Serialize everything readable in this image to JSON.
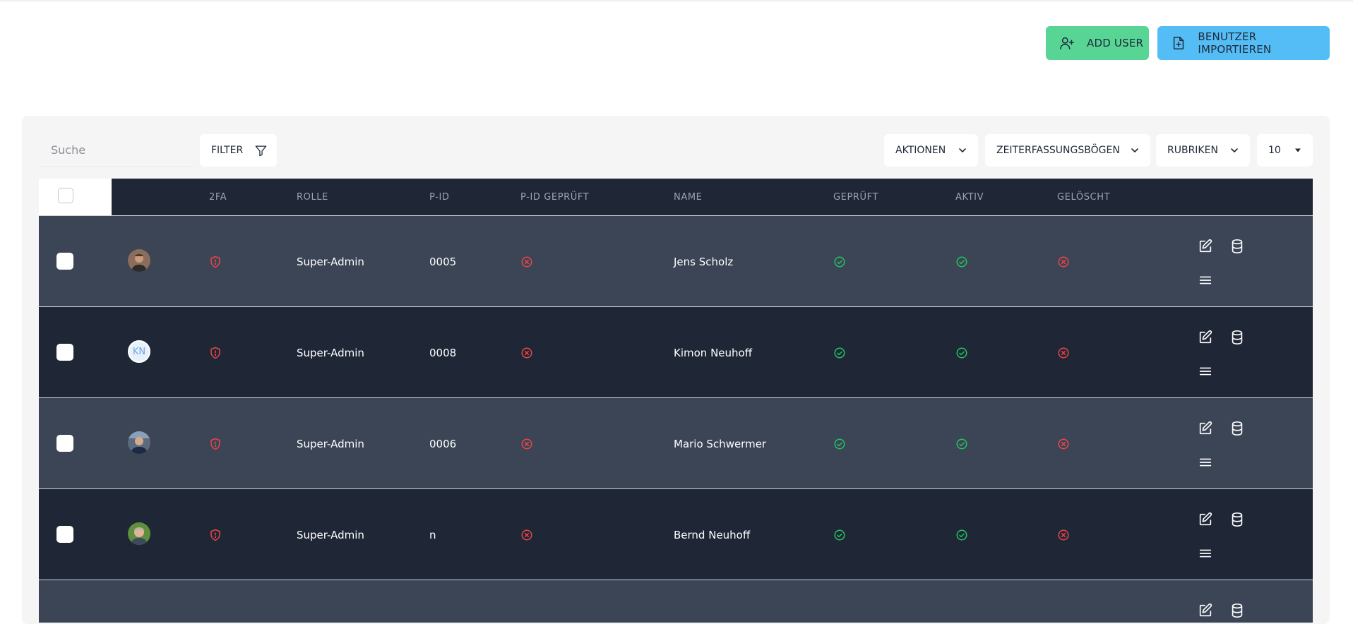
{
  "header": {
    "add_user_label": "ADD USER",
    "import_label": "BENUTZER IMPORTIEREN"
  },
  "toolbar": {
    "search_placeholder": "Suche",
    "filter_label": "FILTER",
    "actions_label": "AKTIONEN",
    "timesheets_label": "ZEITERFASSUNGSBÖGEN",
    "columns_label": "RUBRIKEN",
    "per_page_value": "10"
  },
  "table": {
    "columns": [
      "2FA",
      "ROLLE",
      "P-ID",
      "P-ID GEPRÜFT",
      "NAME",
      "GEPRÜFT",
      "AKTIV",
      "GELÖSCHT"
    ],
    "rows": [
      {
        "role": "Super-Admin",
        "pid": "0005",
        "name": "Jens Scholz",
        "avatar": "photo",
        "two_fa": false,
        "pid_checked": false,
        "checked": true,
        "active": true,
        "deleted": false
      },
      {
        "role": "Super-Admin",
        "pid": "0008",
        "name": "Kimon Neuhoff",
        "avatar": "initials",
        "initials": "KN",
        "two_fa": false,
        "pid_checked": false,
        "checked": true,
        "active": true,
        "deleted": false
      },
      {
        "role": "Super-Admin",
        "pid": "0006",
        "name": "Mario Schwermer",
        "avatar": "photo",
        "two_fa": false,
        "pid_checked": false,
        "checked": true,
        "active": true,
        "deleted": false
      },
      {
        "role": "Super-Admin",
        "pid": "n",
        "name": "Bernd Neuhoff",
        "avatar": "photo",
        "two_fa": false,
        "pid_checked": false,
        "checked": true,
        "active": true,
        "deleted": false
      }
    ]
  },
  "colors": {
    "add_button": "#58d495",
    "import_button": "#55bdf5",
    "row_light": "#3b4556",
    "row_dark": "#1f2737",
    "status_ok": "#22c55e",
    "status_bad": "#ef4444"
  },
  "icons": {
    "add_user": "user-plus-icon",
    "import": "file-plus-icon",
    "filter": "funnel-icon",
    "dropdown": "chevron-down-icon",
    "two_fa_off": "shield-alert-icon",
    "ok": "check-circle-icon",
    "bad": "x-circle-icon",
    "edit": "edit-icon",
    "database": "database-icon",
    "menu": "menu-icon"
  }
}
